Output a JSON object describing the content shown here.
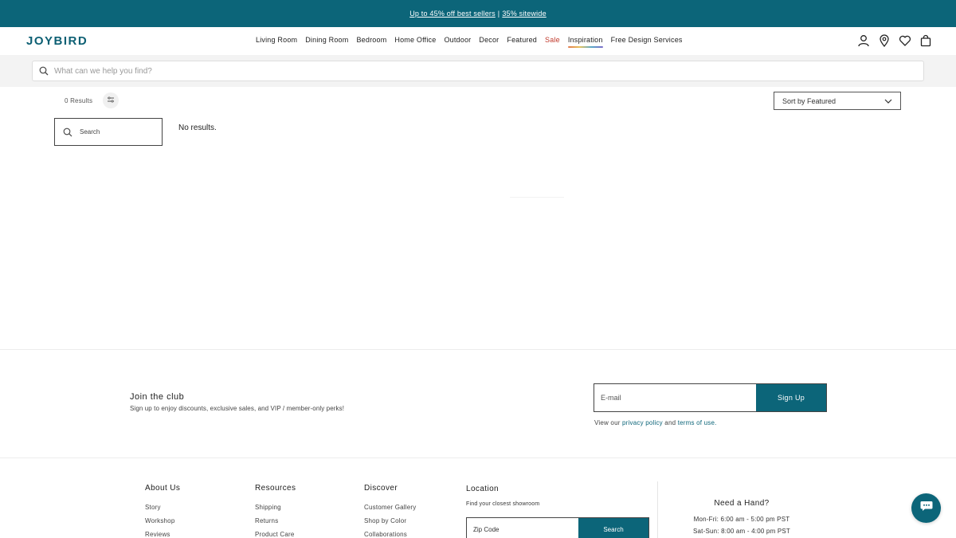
{
  "promo": {
    "link1": "Up to 45% off best sellers",
    "separator": "|",
    "link2": "35% sitewide"
  },
  "header": {
    "logo": "JOYBIRD",
    "nav": [
      "Living Room",
      "Dining Room",
      "Bedroom",
      "Home Office",
      "Outdoor",
      "Decor",
      "Featured",
      "Sale",
      "Inspiration",
      "Free Design Services"
    ]
  },
  "search": {
    "placeholder": "What can we help you find?"
  },
  "results": {
    "count": "0 Results",
    "sort_label": "Sort by Featured",
    "side_search_placeholder": "Search",
    "empty_message": "No results."
  },
  "newsletter": {
    "title": "Join the club",
    "subtitle": "Sign up to enjoy discounts, exclusive sales, and VIP / member-only perks!",
    "email_placeholder": "E-mail",
    "signup_label": "Sign Up",
    "privacy_prefix": "View our",
    "privacy_link": "privacy policy",
    "and": "and",
    "terms_link": "terms of use."
  },
  "footer": {
    "about": {
      "title": "About Us",
      "links": [
        "Story",
        "Workshop",
        "Reviews"
      ]
    },
    "resources": {
      "title": "Resources",
      "links": [
        "Shipping",
        "Returns",
        "Product Care"
      ]
    },
    "discover": {
      "title": "Discover",
      "links": [
        "Customer Gallery",
        "Shop by Color",
        "Collaborations"
      ]
    },
    "location": {
      "title": "Location",
      "subtitle": "Find your closest showroom",
      "zip_placeholder": "Zip Code",
      "search_label": "Search"
    },
    "help": {
      "title": "Need a Hand?",
      "hours1": "Mon-Fri: 6:00 am - 5:00 pm PST",
      "hours2": "Sat-Sun: 8:00 am - 4:00 pm PST"
    }
  },
  "colors": {
    "brand": "#0c6579",
    "sale": "#c0392b"
  },
  "icons": [
    "search-icon",
    "account-icon",
    "location-pin-icon",
    "heart-icon",
    "shopping-bag-icon",
    "filter-icon",
    "chevron-down-icon",
    "chat-icon"
  ]
}
